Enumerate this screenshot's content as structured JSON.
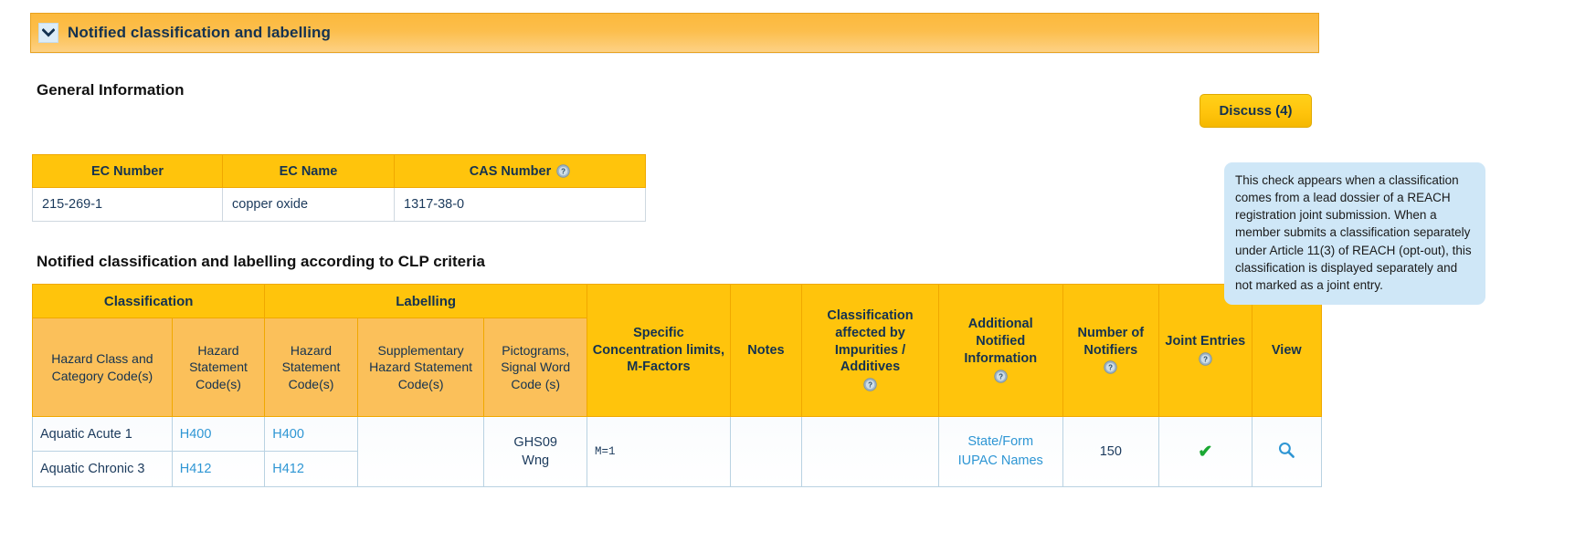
{
  "panel": {
    "title": "Notified classification and labelling",
    "chevron_icon": "chevron-down-icon"
  },
  "general_information": {
    "heading": "General Information",
    "discuss_button": "Discuss (4)",
    "table": {
      "columns": [
        {
          "label": "EC Number",
          "help": false
        },
        {
          "label": "EC Name",
          "help": false
        },
        {
          "label": "CAS Number",
          "help": true
        }
      ],
      "rows": [
        {
          "ec_number": "215-269-1",
          "ec_name": "copper oxide",
          "cas_number": "1317-38-0"
        }
      ]
    }
  },
  "clp_section": {
    "heading": "Notified classification and labelling according to CLP criteria",
    "group_headers": [
      {
        "label": "Classification",
        "span": 2
      },
      {
        "label": "Labelling",
        "span": 3
      }
    ],
    "columns": [
      {
        "key": "hazard_class",
        "label": "Hazard Class and Category Code(s)",
        "help": false
      },
      {
        "key": "hazard_statement_1",
        "label": "Hazard Statement Code(s)",
        "help": false
      },
      {
        "key": "hazard_statement_2",
        "label": "Hazard Statement Code(s)",
        "help": false
      },
      {
        "key": "supplementary",
        "label": "Supplementary Hazard Statement Code(s)",
        "help": false
      },
      {
        "key": "pictograms",
        "label": "Pictograms, Signal Word Code (s)",
        "help": false
      },
      {
        "key": "scl",
        "label": "Specific Concentration limits, M-Factors",
        "help": false
      },
      {
        "key": "notes",
        "label": "Notes",
        "help": false
      },
      {
        "key": "impurities",
        "label": "Classification affected by Impurities / Additives",
        "help": true
      },
      {
        "key": "additional",
        "label": "Additional Notified Information",
        "help": true
      },
      {
        "key": "notifiers",
        "label": "Number of Notifiers",
        "help": true
      },
      {
        "key": "joint",
        "label": "Joint Entries",
        "help": true
      },
      {
        "key": "view",
        "label": "View",
        "help": false
      }
    ],
    "rows": [
      {
        "hazard_class_lines": [
          "Aquatic Acute 1",
          "Aquatic Chronic 3"
        ],
        "hazard_statement_1_lines": [
          "H400",
          "H412"
        ],
        "hazard_statement_2_lines": [
          "H400",
          "H412"
        ],
        "supplementary": "",
        "pictograms_lines": [
          "GHS09",
          "Wng"
        ],
        "scl": "M=1",
        "notes": "",
        "impurities": "",
        "additional_lines": [
          "State/Form",
          "IUPAC Names"
        ],
        "notifiers": "150",
        "joint_icon": "green-check-icon",
        "view_icon": "magnifier-icon"
      }
    ]
  },
  "tooltip": {
    "text": "This check appears when a classification comes from a lead dossier of a REACH registration joint submission. When a member submits a classification separately under Article 11(3) of REACH (opt-out), this classification is displayed separately and not marked as a joint entry."
  },
  "colors": {
    "panel_gradient_start": "#fcb93c",
    "panel_gradient_end": "#fdd185",
    "header_gold": "#ffc40c",
    "subheader_orange": "#fbc05a",
    "link_blue": "#2e96d4",
    "check_green": "#1aa832",
    "tooltip_blue": "#cfe7f7",
    "text_navy": "#143250"
  }
}
